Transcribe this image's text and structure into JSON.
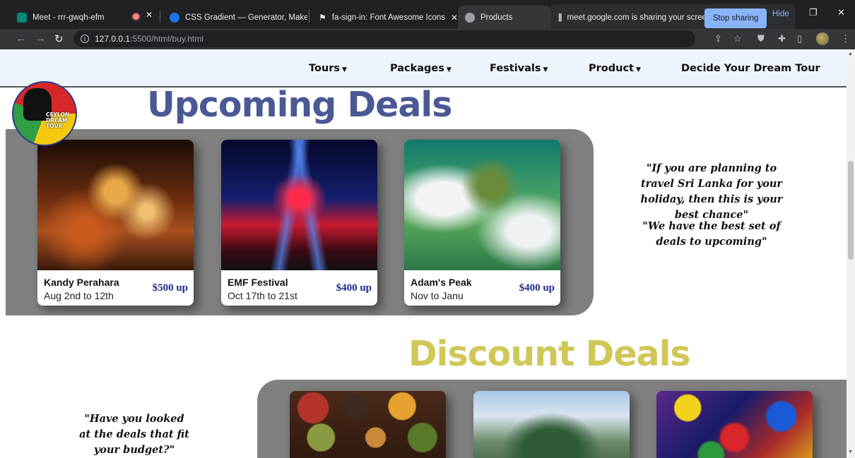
{
  "browser": {
    "tabs": [
      {
        "label": "Meet - rrr-gwqh-efm",
        "icon": "google-meet-icon",
        "color": "#00897b"
      },
      {
        "label": "CSS Gradient — Generator, Make",
        "icon": "css-gradient-icon",
        "color": "#1a73e8"
      },
      {
        "label": "fa-sign-in: Font Awesome Icons",
        "icon": "flag-icon",
        "color": "#e8eaed"
      },
      {
        "label": "Products",
        "icon": "globe-icon",
        "color": "#9aa0a6"
      }
    ],
    "share_bar": {
      "text": "meet.google.com is sharing your screen.",
      "stop_label": "Stop sharing",
      "hide_label": "Hide"
    },
    "url": {
      "host": "127.0.0.1",
      "rest": ":5500/html/buy.html"
    }
  },
  "site": {
    "nav": [
      "Tours",
      "Packages",
      "Festivals",
      "Product",
      "Decide Your Dream Tour"
    ],
    "logo_text": "CEYLON DREAM TOUR",
    "upcoming_title": "Upcoming Deals",
    "upcoming_cards": [
      {
        "title": "Kandy Perahara",
        "date": "Aug 2nd to 12th",
        "price": "$500 up"
      },
      {
        "title": "EMF Festival",
        "date": "Oct 17th to 21st",
        "price": "$400 up"
      },
      {
        "title": "Adam's Peak",
        "date": "Nov to Janu",
        "price": "$400 up"
      }
    ],
    "quote1": "\"If you are planning to travel Sri Lanka for your holiday, then this is your best chance\"",
    "quote2": "\"We have the best set of deals to upcoming\"",
    "discount_title": "Discount Deals",
    "quote3": "\"Have you looked at the deals that fit your budget?\"",
    "colors": {
      "upcoming_title": "#4a5894",
      "discount_title": "#cfc858",
      "price": "#1d2c8c",
      "panel": "#808080"
    }
  }
}
